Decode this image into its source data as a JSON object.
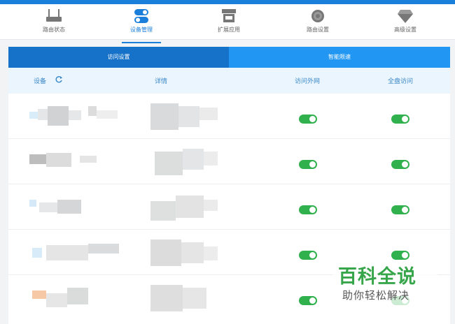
{
  "nav": {
    "items": [
      {
        "label": "路由状态",
        "icon": "router-icon"
      },
      {
        "label": "设备管理",
        "icon": "toggles-icon",
        "active": true
      },
      {
        "label": "扩展应用",
        "icon": "store-icon"
      },
      {
        "label": "路由设置",
        "icon": "gear-icon"
      },
      {
        "label": "高级设置",
        "icon": "diamond-icon"
      }
    ]
  },
  "tabs": {
    "access": "访问设置",
    "speed": "智能限速"
  },
  "table": {
    "headers": {
      "device": "设备",
      "details": "详情",
      "internet": "访问外网",
      "disk": "全盘访问"
    },
    "rows": [
      {
        "internet_access": true,
        "disk_access": true
      },
      {
        "internet_access": true,
        "disk_access": true
      },
      {
        "internet_access": true,
        "disk_access": true
      },
      {
        "internet_access": true,
        "disk_access": true
      },
      {
        "internet_access": true,
        "disk_access": true
      }
    ]
  },
  "watermark": {
    "main": "百科全说",
    "sub": "助你轻松解决"
  },
  "colors": {
    "accent": "#1a7fdb",
    "tab_active": "#1672c8",
    "tab_inactive": "#2196f3",
    "toggle_on": "#31b14d"
  }
}
